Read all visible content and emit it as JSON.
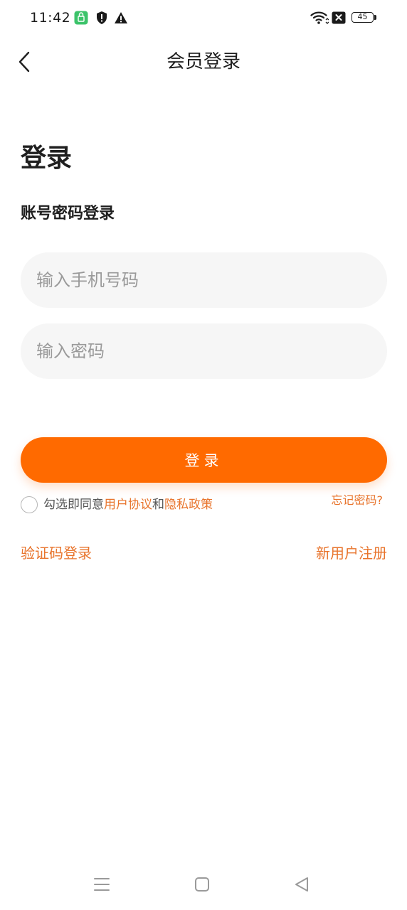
{
  "status_bar": {
    "time": "11:42",
    "battery_level": "45",
    "icons": [
      "app-notification-icon",
      "shield-icon",
      "warning-icon",
      "wifi-icon",
      "sim-disabled-icon",
      "battery-icon"
    ]
  },
  "header": {
    "title": "会员登录",
    "back_icon": "chevron-left-icon"
  },
  "main": {
    "heading": "登录",
    "subheading": "账号密码登录",
    "phone_placeholder": "输入手机号码",
    "phone_value": "",
    "password_placeholder": "输入密码",
    "password_value": "",
    "login_label": "登录",
    "agreement": {
      "prefix": "勾选即同意",
      "user_agreement": "用户协议",
      "and": "和",
      "privacy_policy": "隐私政策",
      "checked": false
    },
    "forgot_password": "忘记密码?",
    "sms_login": "验证码登录",
    "register": "新用户注册"
  },
  "system_nav": {
    "icons": [
      "menu-icon",
      "home-icon",
      "back-triangle-icon"
    ]
  },
  "colors": {
    "accent": "#ff6a00",
    "link": "#e8742c",
    "input_bg": "#f6f6f6"
  }
}
